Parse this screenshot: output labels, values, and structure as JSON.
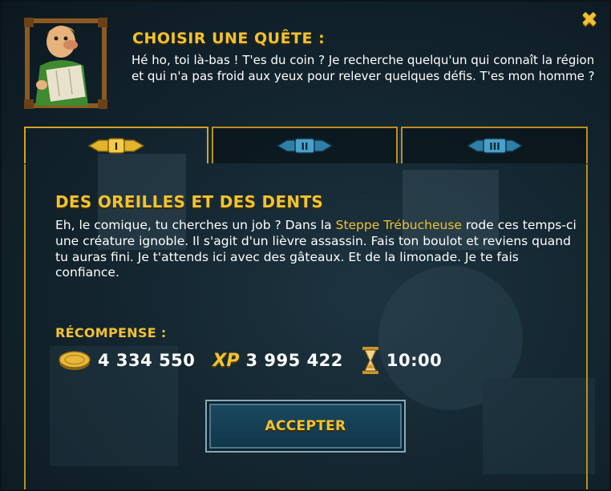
{
  "dialog": {
    "title": "CHOISIR UNE QUÊTE :",
    "intro": "Hé ho, toi là-bas ! T'es du coin ? Je recherche quelqu'un qui connaît la région et qui n'a pas froid aux yeux pour relever quelques défis. T'es mon homme ?",
    "close_icon": "close-icon",
    "portrait": "npc-portrait"
  },
  "tabs": [
    {
      "label": "I",
      "active": true
    },
    {
      "label": "II",
      "active": false
    },
    {
      "label": "III",
      "active": false
    }
  ],
  "quest": {
    "title": "DES OREILLES ET DES DENTS",
    "desc_before": "Eh, le comique, tu cherches un job ? Dans la ",
    "desc_highlight": "Steppe Trébucheuse",
    "desc_after": " rode ces temps-ci une créature ignoble. Il s'agit d'un lièvre assassin. Fais ton boulot et reviens quand tu auras fini. Je t'attends ici avec des gâteaux. Et de la limonade. Je te fais confiance."
  },
  "reward": {
    "label": "RÉCOMPENSE :",
    "gold": "4 334 550",
    "xp_label": "XP",
    "xp": "3 995 422",
    "time": "10:00"
  },
  "actions": {
    "accept_label": "ACCEPTER"
  },
  "colors": {
    "accent": "#f2c230",
    "tab_active": "#d2a22a",
    "tab_inactive_badge": "#3a8ab0",
    "button": "#1b4a60"
  }
}
